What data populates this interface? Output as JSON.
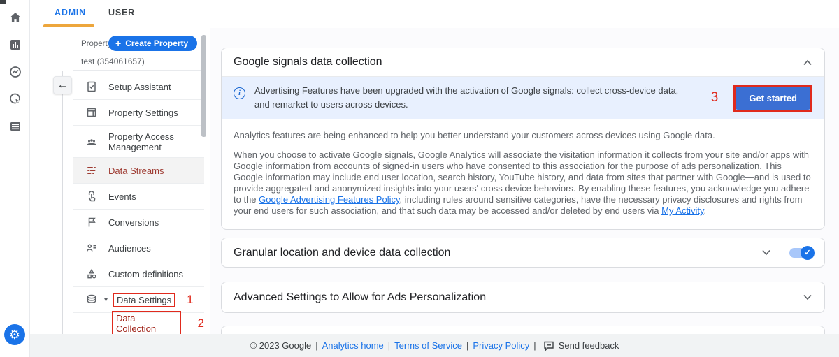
{
  "colors": {
    "accent_blue": "#1a73e8",
    "banner_blue_bg": "#e8f0fe",
    "annotation_red": "#e02a1d",
    "active_nav_maroon": "#9e3b32",
    "selected_nav_maroon": "#9e1d12",
    "tab_underline_orange": "#eda63c",
    "get_started_blue": "#3b6fd3",
    "footer_bg": "#f1f3f4"
  },
  "icons": {
    "plus": "+",
    "back_arrow": "←",
    "triangle_down": "▾",
    "gear": "⚙",
    "info": "i",
    "check": "✓"
  },
  "header": {
    "tabs": [
      {
        "label": "ADMIN",
        "active": true
      },
      {
        "label": "USER",
        "active": false
      }
    ]
  },
  "sidebar": {
    "property_label": "Property",
    "create_property_button": "Create Property",
    "property_name": "test (354061657)",
    "items": [
      {
        "label": "Setup Assistant"
      },
      {
        "label": "Property Settings"
      },
      {
        "label": "Property Access Management"
      },
      {
        "label": "Data Streams",
        "active": true
      },
      {
        "label": "Events"
      },
      {
        "label": "Conversions"
      },
      {
        "label": "Audiences"
      },
      {
        "label": "Custom definitions"
      },
      {
        "label": "Data Settings",
        "annotation": "1"
      },
      {
        "label": "Data Collection",
        "annotation": "2",
        "selected": true
      }
    ]
  },
  "main": {
    "google_signals_card": {
      "title": "Google signals data collection",
      "banner": {
        "text": "Advertising Features have been upgraded with the activation of Google signals: collect cross-device data, and remarket to users across devices.",
        "annotation": "3",
        "button_label": "Get started"
      },
      "paragraph1": "Analytics features are being enhanced to help you better understand your customers across devices using Google data.",
      "paragraph2_part1": "When you choose to activate Google signals, Google Analytics will associate the visitation information it collects from your site and/or apps with Google information from accounts of signed-in users who have consented to this association for the purpose of ads personalization. This Google information may include end user location, search history, YouTube history, and data from sites that partner with Google—and is used to provide aggregated and anonymized insights into your users' cross device behaviors. By enabling these features, you acknowledge you adhere to the ",
      "link1": "Google Advertising Features Policy",
      "paragraph2_part2": ", including rules around sensitive categories, have the necessary privacy disclosures and rights from your end users for such association, and that such data may be accessed and/or deleted by end users via ",
      "link2": "My Activity",
      "paragraph2_part3": "."
    },
    "granular_card": {
      "title": "Granular location and device data collection",
      "toggle_on": true
    },
    "advanced_card": {
      "title": "Advanced Settings to Allow for Ads Personalization"
    }
  },
  "footer": {
    "copyright": "© 2023 Google",
    "separator": "|",
    "links": [
      {
        "label": "Analytics home"
      },
      {
        "label": "Terms of Service"
      },
      {
        "label": "Privacy Policy"
      }
    ],
    "send_feedback": "Send feedback"
  }
}
